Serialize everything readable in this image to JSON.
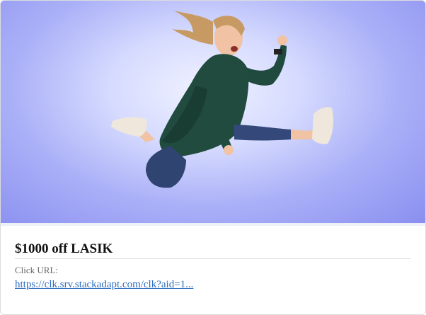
{
  "ad": {
    "image_alt": "Woman jumping in mid-air",
    "title": "$1000 off LASIK",
    "click_url_label": "Click URL:",
    "click_url": "https://clk.srv.stackadapt.com/clk?aid=1..."
  },
  "colors": {
    "background_top": "#8a8ff0",
    "link": "#2a6cbf",
    "title": "#111111"
  }
}
